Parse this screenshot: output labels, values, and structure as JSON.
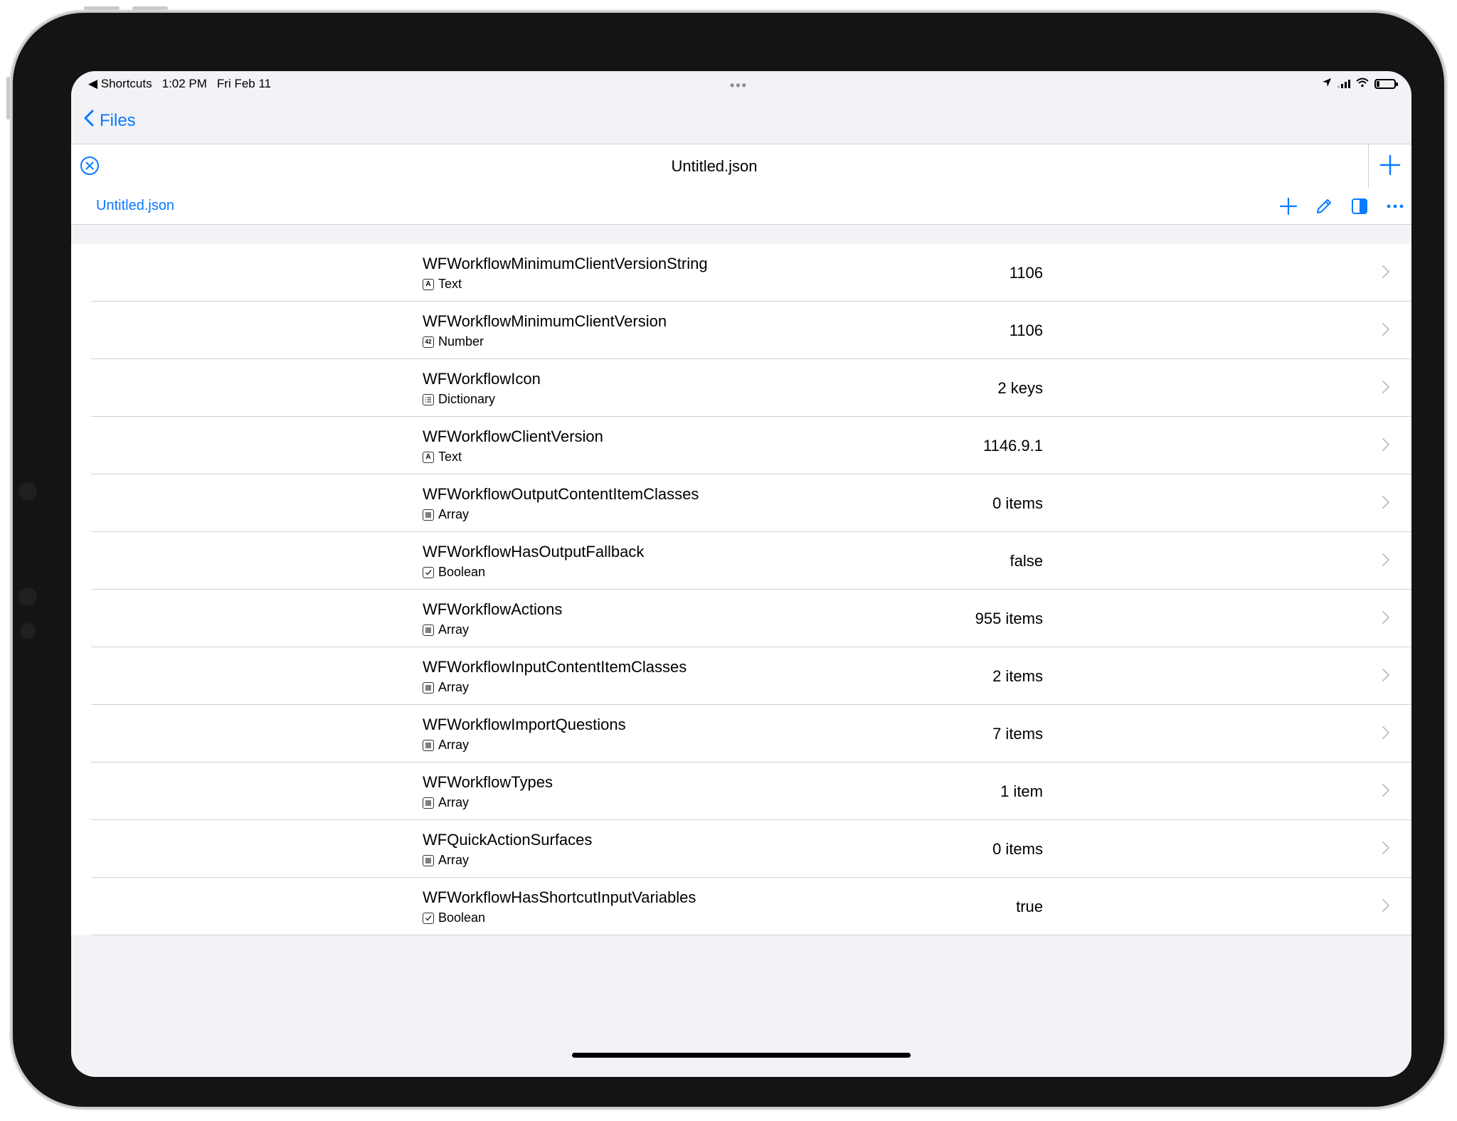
{
  "status_bar": {
    "back_app": "◀ Shortcuts",
    "time": "1:02 PM",
    "date": "Fri Feb 11",
    "dots": "•••"
  },
  "nav": {
    "back_label": "Files"
  },
  "document": {
    "title": "Untitled.json"
  },
  "breadcrumb": {
    "current": "Untitled.json"
  },
  "toolbar": {
    "icons": [
      "plus-icon",
      "pencil-icon",
      "sidebar-icon",
      "ellipsis-icon"
    ]
  },
  "colors": {
    "accent": "#0a7aff",
    "background": "#f2f2f7",
    "separator": "#d1d1d6"
  },
  "rows": [
    {
      "key": "WFWorkflowMinimumClientVersionString",
      "type": "Text",
      "type_icon": "text-icon",
      "value": "1106"
    },
    {
      "key": "WFWorkflowMinimumClientVersion",
      "type": "Number",
      "type_icon": "number-icon",
      "value": "1106"
    },
    {
      "key": "WFWorkflowIcon",
      "type": "Dictionary",
      "type_icon": "dictionary-icon",
      "value": "2 keys"
    },
    {
      "key": "WFWorkflowClientVersion",
      "type": "Text",
      "type_icon": "text-icon",
      "value": "1146.9.1"
    },
    {
      "key": "WFWorkflowOutputContentItemClasses",
      "type": "Array",
      "type_icon": "array-icon",
      "value": "0 items"
    },
    {
      "key": "WFWorkflowHasOutputFallback",
      "type": "Boolean",
      "type_icon": "boolean-icon",
      "value": "false"
    },
    {
      "key": "WFWorkflowActions",
      "type": "Array",
      "type_icon": "array-icon",
      "value": "955 items"
    },
    {
      "key": "WFWorkflowInputContentItemClasses",
      "type": "Array",
      "type_icon": "array-icon",
      "value": "2 items"
    },
    {
      "key": "WFWorkflowImportQuestions",
      "type": "Array",
      "type_icon": "array-icon",
      "value": "7 items"
    },
    {
      "key": "WFWorkflowTypes",
      "type": "Array",
      "type_icon": "array-icon",
      "value": "1 item"
    },
    {
      "key": "WFQuickActionSurfaces",
      "type": "Array",
      "type_icon": "array-icon",
      "value": "0 items"
    },
    {
      "key": "WFWorkflowHasShortcutInputVariables",
      "type": "Boolean",
      "type_icon": "boolean-icon",
      "value": "true"
    }
  ]
}
